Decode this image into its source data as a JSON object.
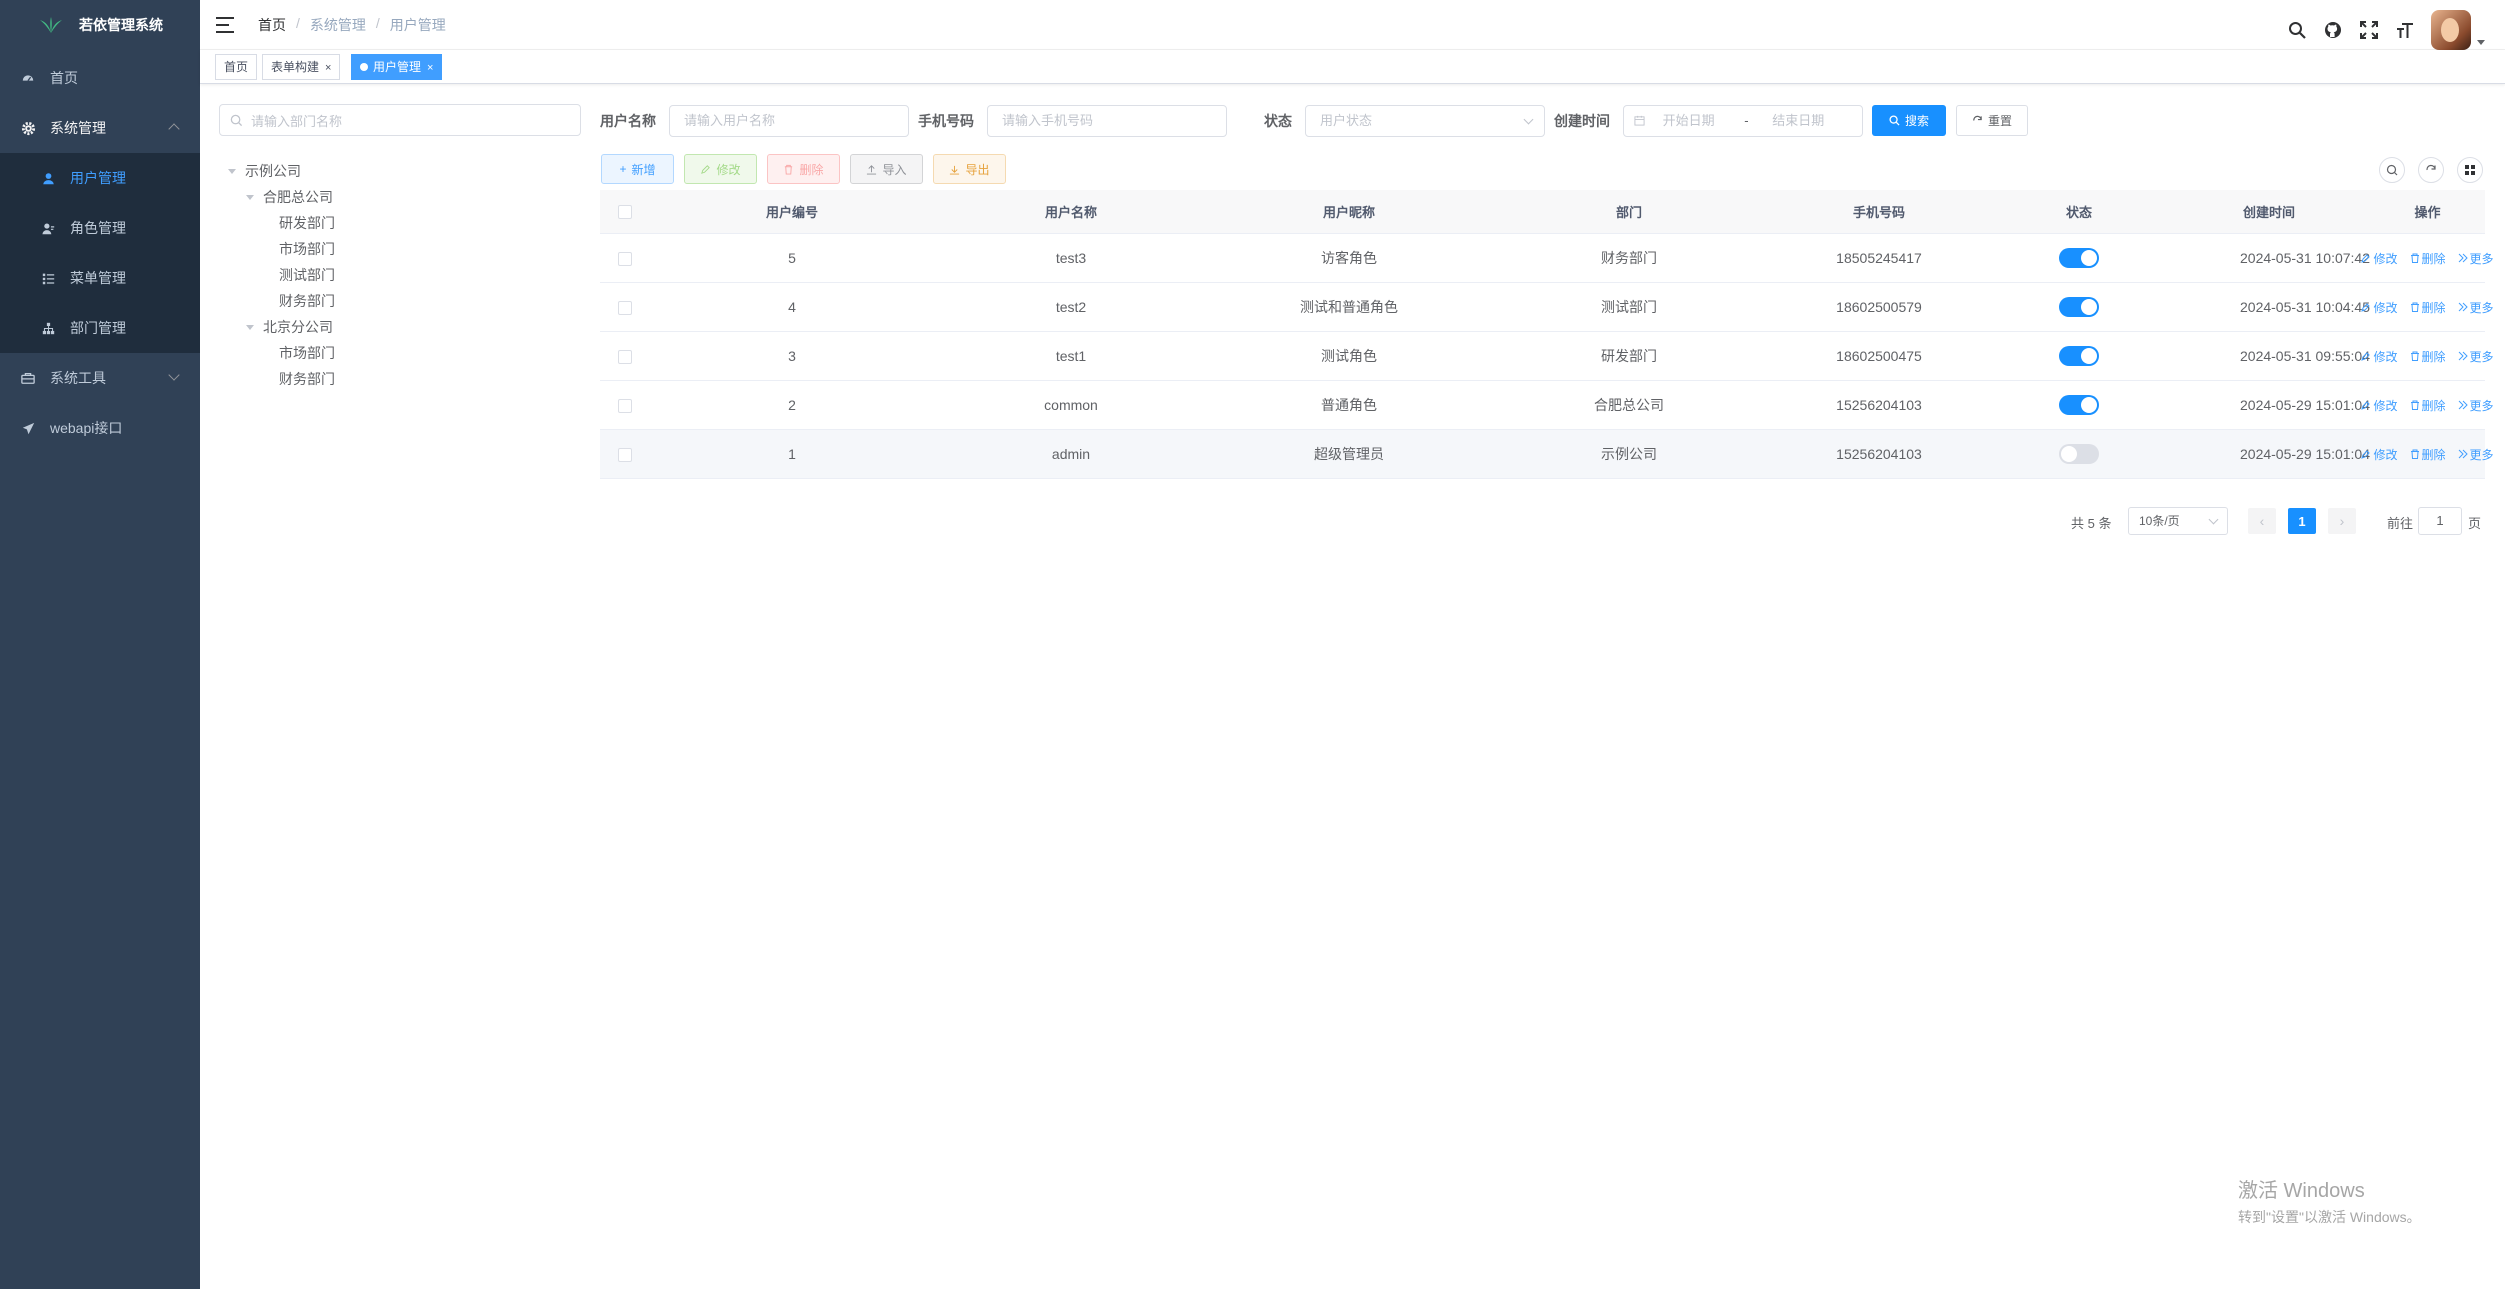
{
  "app": {
    "title": "若依管理系统"
  },
  "sidebar": {
    "items": [
      {
        "label": "首页",
        "icon": "dashboard-icon"
      },
      {
        "label": "系统管理",
        "icon": "gear-icon"
      },
      {
        "label": "系统工具",
        "icon": "toolbox-icon"
      },
      {
        "label": "webapi接口",
        "icon": "paper-plane-icon"
      }
    ],
    "sub_items": [
      {
        "label": "用户管理",
        "icon": "user-icon"
      },
      {
        "label": "角色管理",
        "icon": "role-icon"
      },
      {
        "label": "菜单管理",
        "icon": "menu-list-icon"
      },
      {
        "label": "部门管理",
        "icon": "tree-structure-icon"
      }
    ]
  },
  "breadcrumb": {
    "home": "首页",
    "parent": "系统管理",
    "current": "用户管理"
  },
  "tags": [
    {
      "label": "首页"
    },
    {
      "label": "表单构建",
      "close": "×"
    },
    {
      "label": "用户管理",
      "close": "×"
    }
  ],
  "dept_tree": {
    "placeholder": "请输入部门名称",
    "nodes": [
      "示例公司",
      "合肥总公司",
      "研发部门",
      "市场部门",
      "测试部门",
      "财务部门",
      "北京分公司",
      "市场部门",
      "财务部门"
    ]
  },
  "search_form": {
    "username_label": "用户名称",
    "username_placeholder": "请输入用户名称",
    "phone_label": "手机号码",
    "phone_placeholder": "请输入手机号码",
    "status_label": "状态",
    "status_placeholder": "用户状态",
    "created_label": "创建时间",
    "start_placeholder": "开始日期",
    "range_sep": "-",
    "end_placeholder": "结束日期",
    "search_button": "搜索",
    "reset_button": "重置"
  },
  "toolbar": {
    "add": "新增",
    "edit": "修改",
    "delete": "删除",
    "import": "导入",
    "export": "导出"
  },
  "table": {
    "headers": [
      "用户编号",
      "用户名称",
      "用户昵称",
      "部门",
      "手机号码",
      "状态",
      "创建时间",
      "操作"
    ],
    "rows": [
      {
        "id": "5",
        "username": "test3",
        "nickname": "访客角色",
        "dept": "财务部门",
        "phone": "18505245417",
        "enabled": true,
        "created": "2024-05-31 10:07:42"
      },
      {
        "id": "4",
        "username": "test2",
        "nickname": "测试和普通角色",
        "dept": "测试部门",
        "phone": "18602500579",
        "enabled": true,
        "created": "2024-05-31 10:04:45"
      },
      {
        "id": "3",
        "username": "test1",
        "nickname": "测试角色",
        "dept": "研发部门",
        "phone": "18602500475",
        "enabled": true,
        "created": "2024-05-31 09:55:04"
      },
      {
        "id": "2",
        "username": "common",
        "nickname": "普通角色",
        "dept": "合肥总公司",
        "phone": "15256204103",
        "enabled": true,
        "created": "2024-05-29 15:01:04"
      },
      {
        "id": "1",
        "username": "admin",
        "nickname": "超级管理员",
        "dept": "示例公司",
        "phone": "15256204103",
        "enabled": false,
        "created": "2024-05-29 15:01:04"
      }
    ],
    "actions": {
      "edit": "修改",
      "delete": "删除",
      "more": "更多"
    }
  },
  "pagination": {
    "total": "共 5 条",
    "page_size": "10条/页",
    "current": "1",
    "goto": "前往",
    "goto_value": "1",
    "page_unit": "页"
  },
  "watermark": {
    "line1": "激活 Windows",
    "line2": "转到\"设置\"以激活 Windows。"
  },
  "colors": {
    "sidebar_bg": "#304156",
    "primary": "#1890ff",
    "active_menu": "#409eff"
  }
}
